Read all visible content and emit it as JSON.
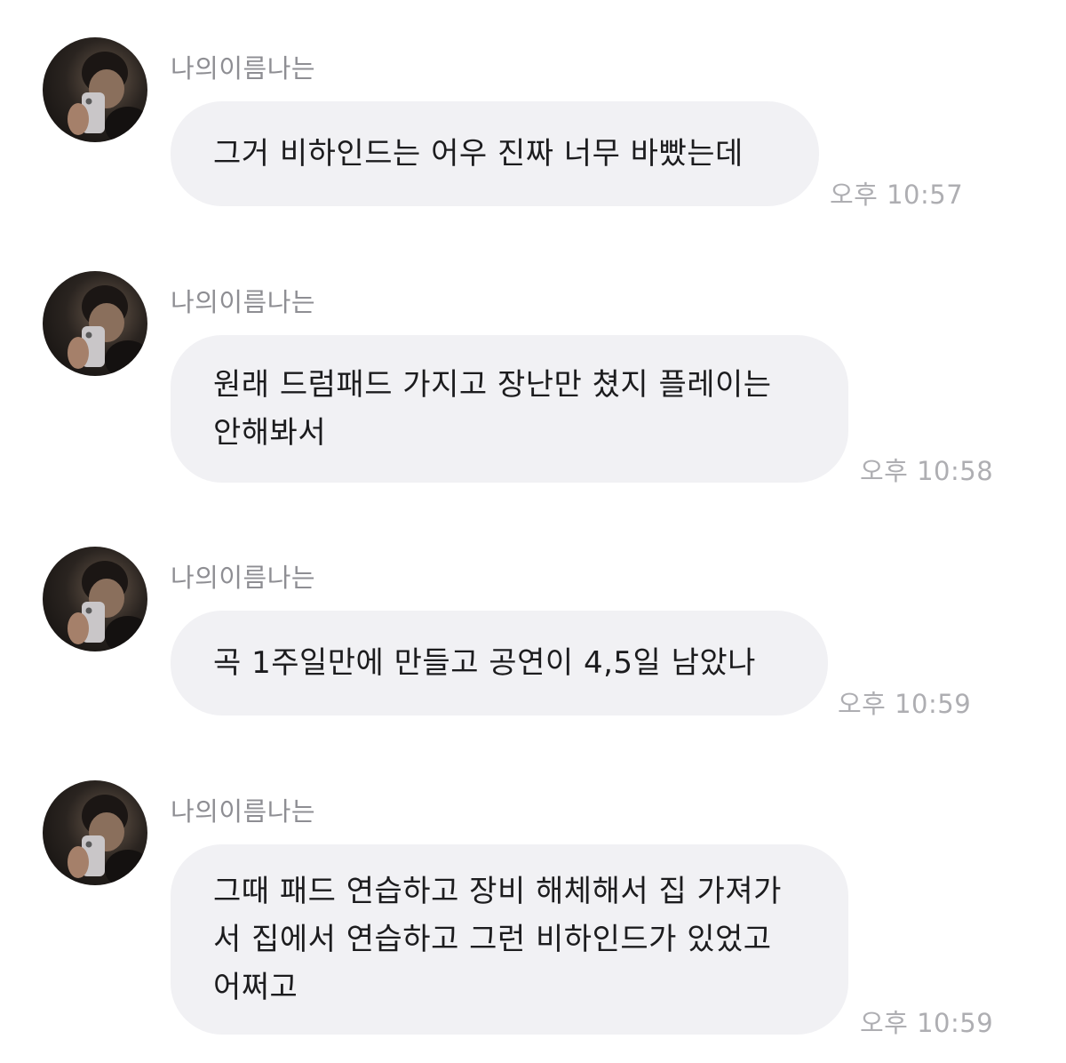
{
  "messages": [
    {
      "sender": "나의이름나는",
      "text": "그거 비하인드는 어우 진짜 너무 바빴는데",
      "time": "오후 10:57"
    },
    {
      "sender": "나의이름나는",
      "text": "원래 드럼패드 가지고 장난만 쳤지 플레이는\n안해봐서",
      "time": "오후 10:58"
    },
    {
      "sender": "나의이름나는",
      "text": "곡 1주일만에 만들고 공연이 4,5일 남았나",
      "time": "오후 10:59"
    },
    {
      "sender": "나의이름나는",
      "text": "그때 패드 연습하고 장비 해체해서 집 가져가\n서 집에서 연습하고 그런 비하인드가 있었고\n어쩌고",
      "time": "오후 10:59"
    }
  ],
  "colors": {
    "bubble": "#f1f1f4",
    "sender": "#8e8e93",
    "time": "#aeaeb2",
    "text": "#1c1c1e"
  }
}
